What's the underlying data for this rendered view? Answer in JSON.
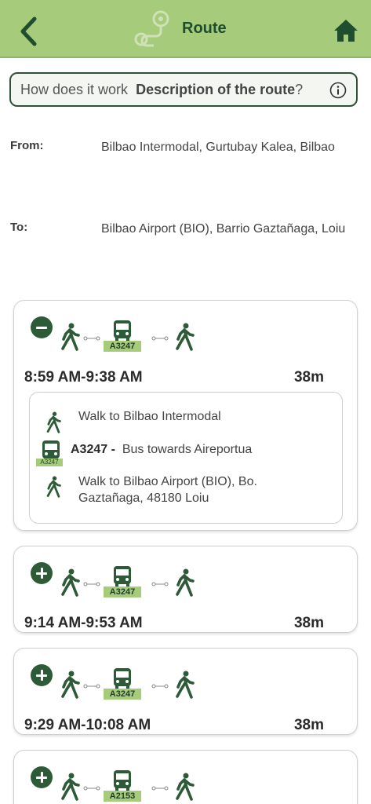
{
  "header": {
    "title": "Route"
  },
  "info_bar": {
    "prefix": "How does it work",
    "bold": "Description of the route",
    "suffix": "?"
  },
  "from": {
    "label": "From:",
    "value": "Bilbao Intermodal, Gurtubay Kalea, Bilbao"
  },
  "to": {
    "label": "To:",
    "value": "Bilbao Airport (BIO), Barrio Gaztañaga, Loiu"
  },
  "routes": [
    {
      "expanded": true,
      "bus_line": "A3247",
      "time_range": "8:59 AM-9:38 AM",
      "duration": "38m"
    },
    {
      "expanded": false,
      "bus_line": "A3247",
      "time_range": "9:14 AM-9:53 AM",
      "duration": "38m"
    },
    {
      "expanded": false,
      "bus_line": "A3247",
      "time_range": "9:29 AM-10:08 AM",
      "duration": "38m"
    },
    {
      "expanded": false,
      "bus_line": "A2153",
      "time_range": "",
      "duration": ""
    }
  ],
  "detail": {
    "step1": "Walk to Bilbao Intermodal",
    "step2_line": "A3247 -",
    "step2_text": "Bus towards Aireportua",
    "step2_badge": "A3247",
    "step3_line1": "Walk to Bilbao Airport (BIO), Bo.",
    "step3_line2": "Gaztañaga, 48180 Loiu"
  },
  "colors": {
    "header": "#a6cb7a",
    "accent": "#2d5a37",
    "badge": "#a6cb7a"
  }
}
